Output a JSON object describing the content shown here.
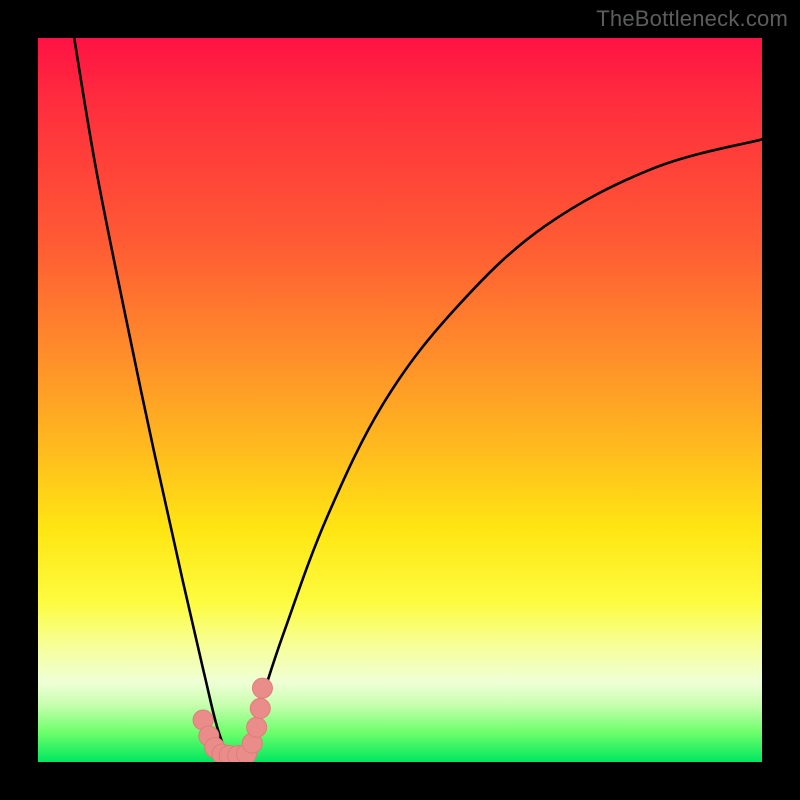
{
  "watermark": "TheBottleneck.com",
  "colors": {
    "frame": "#000000",
    "curve_stroke": "#000000",
    "marker_fill": "#ea8d8a",
    "marker_stroke": "#e07c78",
    "gradient_top": "#ff1244",
    "gradient_bottom": "#00e760"
  },
  "chart_data": {
    "type": "line",
    "title": "",
    "xlabel": "",
    "ylabel": "",
    "xlim": [
      0,
      100
    ],
    "ylim": [
      0,
      100
    ],
    "grid": false,
    "legend": false,
    "note": "V-shaped bottleneck curve. y≈0 (optimal, green) near x≈27; y rises sharply toward 100 (red) away from optimum. Values estimated from pixel positions against the color gradient.",
    "series": [
      {
        "name": "bottleneck-curve",
        "x": [
          5,
          8,
          12,
          16,
          20,
          23,
          25,
          27,
          29,
          31,
          34,
          40,
          48,
          58,
          70,
          85,
          100
        ],
        "y": [
          100,
          82,
          62,
          43,
          25,
          12,
          4,
          0,
          3,
          9,
          18,
          34,
          50,
          63,
          74,
          82,
          86
        ]
      }
    ],
    "markers": {
      "name": "highlight-dots",
      "note": "salmon circular markers near the trough of the V",
      "x": [
        22.8,
        23.6,
        24.4,
        25.4,
        26.4,
        27.6,
        28.8,
        29.6,
        30.2,
        30.7,
        31.0
      ],
      "y": [
        5.8,
        3.6,
        2.0,
        1.1,
        0.9,
        0.9,
        1.1,
        2.6,
        4.8,
        7.4,
        10.2
      ]
    },
    "background_gradient": {
      "orientation": "vertical",
      "meaning": "color encodes y-value: red=high bottleneck, green=none",
      "stops": [
        {
          "pos": 0.0,
          "color": "#ff1244"
        },
        {
          "pos": 0.28,
          "color": "#ff5a34"
        },
        {
          "pos": 0.56,
          "color": "#ffb81f"
        },
        {
          "pos": 0.78,
          "color": "#fdfc40"
        },
        {
          "pos": 0.92,
          "color": "#c9ffb0"
        },
        {
          "pos": 1.0,
          "color": "#00e760"
        }
      ]
    }
  }
}
